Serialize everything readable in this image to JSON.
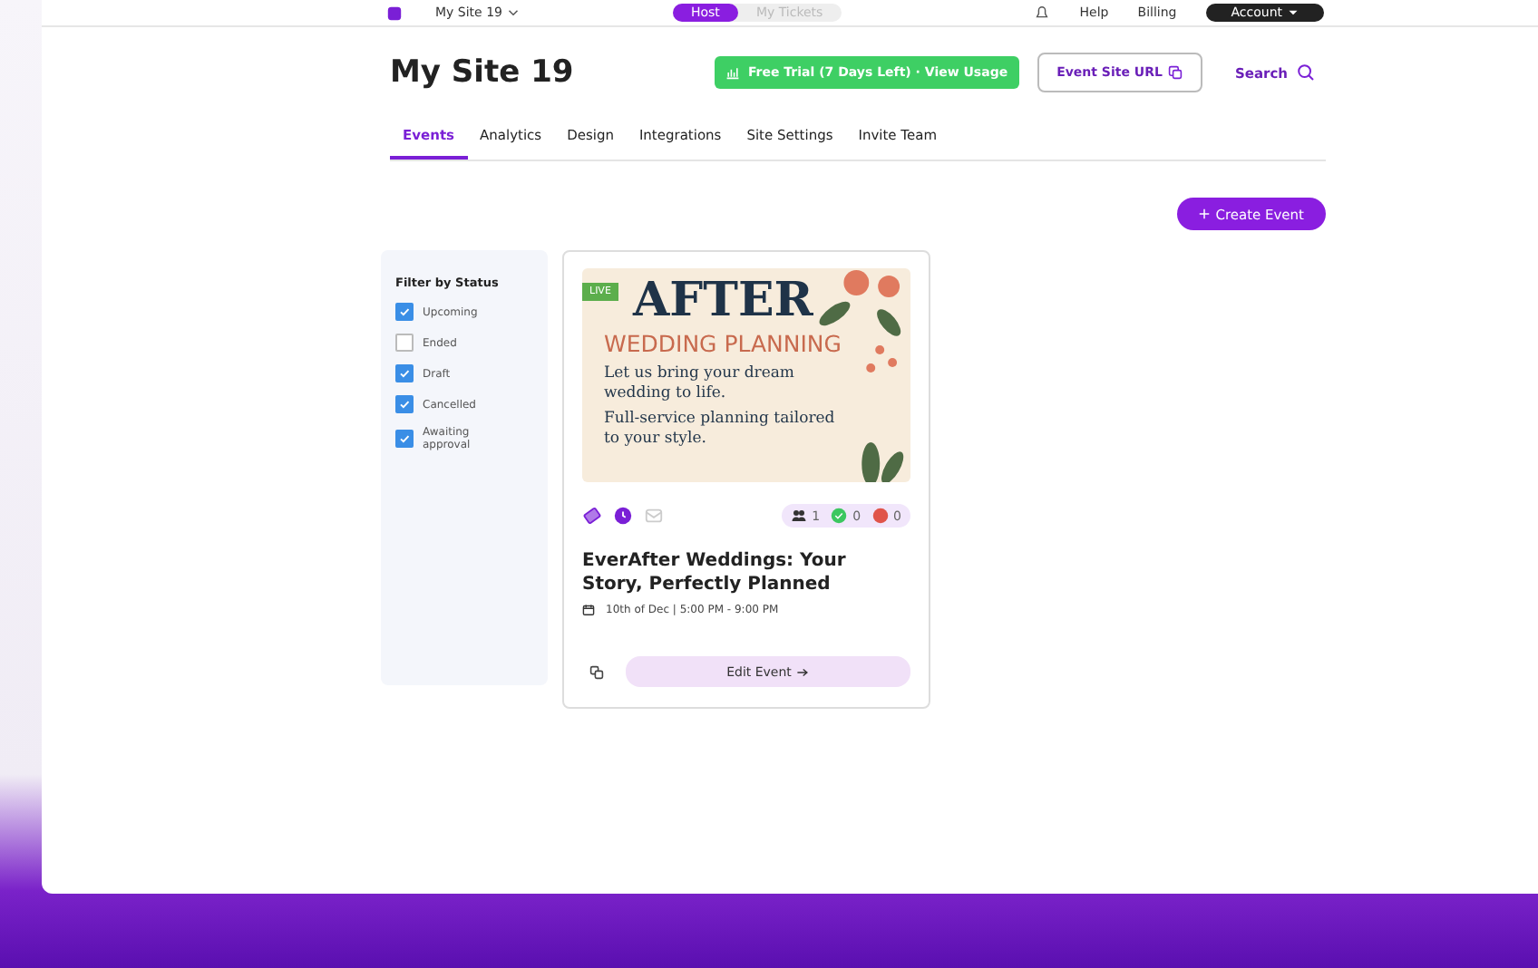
{
  "top_bar": {
    "site": "My Site 19",
    "modes": [
      {
        "label": "Host",
        "selected": true
      },
      {
        "label": "My Tickets",
        "selected": false
      }
    ],
    "links": [
      "Help",
      "Billing"
    ],
    "account": "Account"
  },
  "header": {
    "title": "My Site 19",
    "trial_button": "Free Trial (7 Days Left) · View Usage",
    "url_button": "Event Site URL",
    "search": "Search"
  },
  "tabs": [
    {
      "label": "Events",
      "selected": true
    },
    {
      "label": "Analytics",
      "selected": false
    },
    {
      "label": "Design",
      "selected": false
    },
    {
      "label": "Integrations",
      "selected": false
    },
    {
      "label": "Site Settings",
      "selected": false
    },
    {
      "label": "Invite Team",
      "selected": false
    }
  ],
  "create_button": "Create Event",
  "filter": {
    "title": "Filter by Status",
    "options": [
      {
        "label": "Upcoming",
        "checked": true
      },
      {
        "label": "Ended",
        "checked": false
      },
      {
        "label": "Draft",
        "checked": true
      },
      {
        "label": "Cancelled",
        "checked": true
      },
      {
        "label": "Awaiting approval",
        "checked": true
      }
    ]
  },
  "event": {
    "badge": "LIVE",
    "flyer": {
      "heading": "AFTER",
      "subheading": "WEDDING PLANNING",
      "lines": [
        "Let us bring your dream wedding to life.",
        "Full-service planning tailored to your style."
      ]
    },
    "counts": [
      {
        "kind": "guests",
        "value": "1"
      },
      {
        "kind": "approved",
        "value": "0"
      },
      {
        "kind": "declined",
        "value": "0"
      }
    ],
    "title": "EverAfter Weddings: Your Story, Perfectly Planned",
    "date": "10th of Dec | 5:00 PM - 9:00 PM",
    "edit_button": "Edit Event"
  }
}
